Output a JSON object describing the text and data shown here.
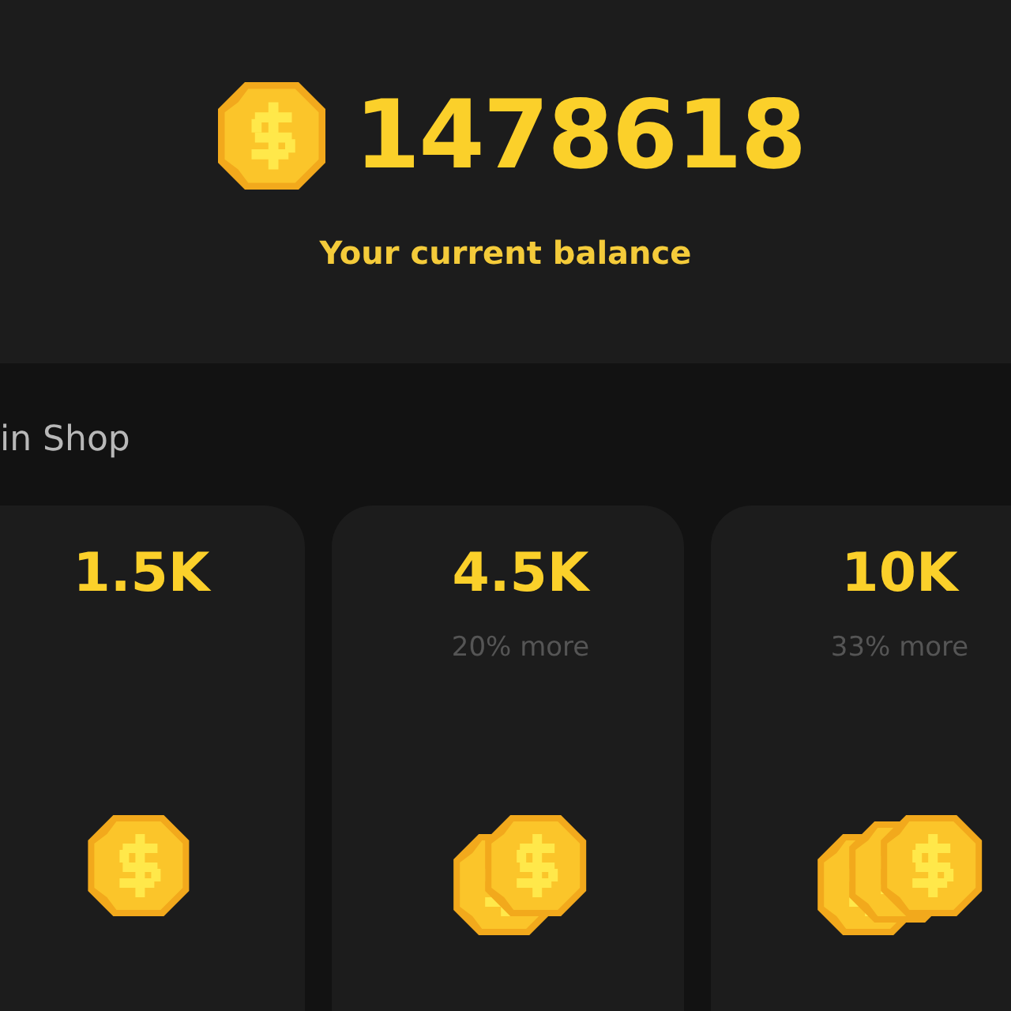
{
  "balance": {
    "amount": "1478618",
    "label": "Your current balance"
  },
  "section_title": "in Shop",
  "packs": [
    {
      "amount": "1.5K",
      "kind": "single"
    },
    {
      "amount": "4.5K",
      "note": "20% more",
      "kind": "double"
    },
    {
      "amount": "10K",
      "note": "33% more",
      "kind": "triple"
    }
  ]
}
